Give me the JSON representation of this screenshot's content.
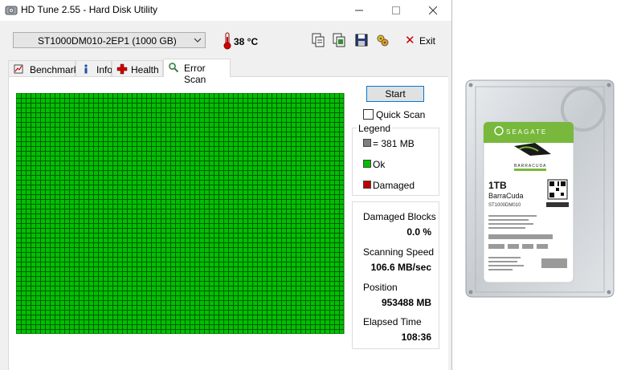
{
  "window": {
    "title": "HD Tune 2.55 - Hard Disk Utility"
  },
  "toolbar": {
    "drive": "ST1000DM010-2EP1 (1000 GB)",
    "temperature": "38 °C",
    "exit_label": "Exit"
  },
  "tabs": [
    {
      "label": "Benchmark",
      "active": false
    },
    {
      "label": "Info",
      "active": false
    },
    {
      "label": "Health",
      "active": false
    },
    {
      "label": "Error Scan",
      "active": true
    }
  ],
  "scan": {
    "start_label": "Start",
    "quick_scan_label": "Quick Scan",
    "quick_scan_checked": false,
    "block_color": "#00c000",
    "block_grid_color": "#005a00",
    "all_blocks_ok": true
  },
  "legend": {
    "title": "Legend",
    "items": [
      {
        "label": "= 381 MB",
        "color": "#808080"
      },
      {
        "label": "Ok",
        "color": "#00c000"
      },
      {
        "label": "Damaged",
        "color": "#c00000"
      }
    ]
  },
  "stats": {
    "damaged_blocks_label": "Damaged Blocks",
    "damaged_blocks_value": "0.0 %",
    "scanning_speed_label": "Scanning Speed",
    "scanning_speed_value": "106.6 MB/sec",
    "position_label": "Position",
    "position_value": "953488 MB",
    "elapsed_label": "Elapsed Time",
    "elapsed_value": "108:36"
  },
  "drive_label": {
    "brand": "SEAGATE",
    "series": "BARRACUDA",
    "capacity": "1TB",
    "name": "BarraCuda",
    "model": "ST1000DM010"
  }
}
